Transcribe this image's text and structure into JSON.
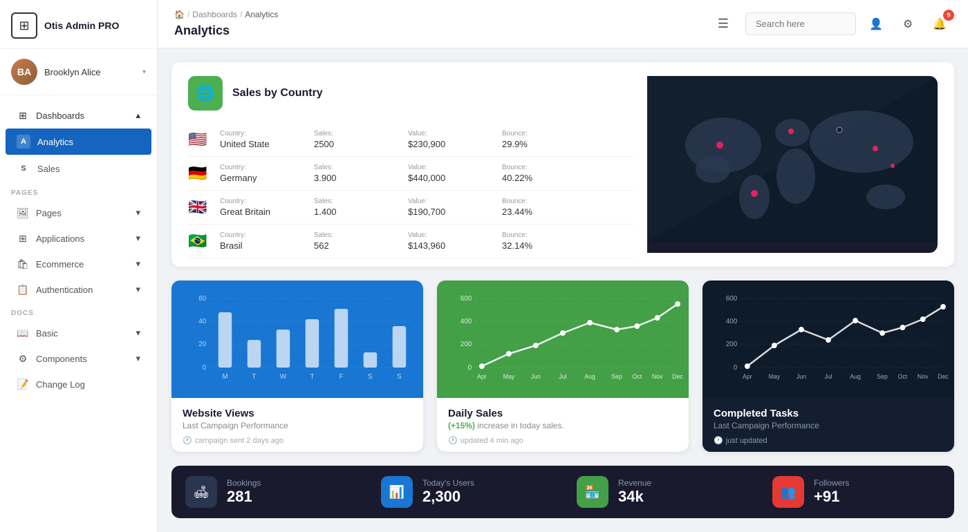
{
  "sidebar": {
    "logo": {
      "icon": "⊞",
      "text": "Otis Admin PRO"
    },
    "user": {
      "name": "Brooklyn Alice",
      "initials": "BA"
    },
    "nav": {
      "dashboards_label": "Dashboards",
      "analytics_label": "Analytics",
      "sales_label": "Sales",
      "pages_section": "PAGES",
      "pages_label": "Pages",
      "applications_label": "Applications",
      "ecommerce_label": "Ecommerce",
      "authentication_label": "Authentication",
      "docs_section": "DOCS",
      "basic_label": "Basic",
      "components_label": "Components",
      "changelog_label": "Change Log"
    }
  },
  "topbar": {
    "breadcrumb": {
      "home": "🏠",
      "sep1": "/",
      "dashboards": "Dashboards",
      "sep2": "/",
      "current": "Analytics"
    },
    "title": "Analytics",
    "hamburger": "☰",
    "search_placeholder": "Search here",
    "notification_count": "9"
  },
  "sales_country": {
    "card_title": "Sales by Country",
    "rows": [
      {
        "flag": "🇺🇸",
        "country_label": "Country:",
        "country": "United State",
        "sales_label": "Sales:",
        "sales": "2500",
        "value_label": "Value:",
        "value": "$230,900",
        "bounce_label": "Bounce:",
        "bounce": "29.9%"
      },
      {
        "flag": "🇩🇪",
        "country_label": "Country:",
        "country": "Germany",
        "sales_label": "Sales:",
        "sales": "3.900",
        "value_label": "Value:",
        "value": "$440,000",
        "bounce_label": "Bounce:",
        "bounce": "40.22%"
      },
      {
        "flag": "🇬🇧",
        "country_label": "Country:",
        "country": "Great Britain",
        "sales_label": "Sales:",
        "sales": "1.400",
        "value_label": "Value:",
        "value": "$190,700",
        "bounce_label": "Bounce:",
        "bounce": "23.44%"
      },
      {
        "flag": "🇧🇷",
        "country_label": "Country:",
        "country": "Brasil",
        "sales_label": "Sales:",
        "sales": "562",
        "value_label": "Value:",
        "value": "$143,960",
        "bounce_label": "Bounce:",
        "bounce": "32.14%"
      }
    ]
  },
  "chart_website": {
    "title": "Website Views",
    "subtitle": "Last Campaign Performance",
    "time_label": "campaign sent 2 days ago",
    "y_labels": [
      "60",
      "40",
      "20",
      "0"
    ],
    "x_labels": [
      "M",
      "T",
      "W",
      "T",
      "F",
      "S",
      "S"
    ]
  },
  "chart_daily": {
    "title": "Daily Sales",
    "subtitle_prefix": "(+15%)",
    "subtitle_suffix": "increase in today sales.",
    "time_label": "updated 4 min ago",
    "y_labels": [
      "600",
      "400",
      "200",
      "0"
    ],
    "x_labels": [
      "Apr",
      "May",
      "Jun",
      "Jul",
      "Aug",
      "Sep",
      "Oct",
      "Nov",
      "Dec"
    ]
  },
  "chart_tasks": {
    "title": "Completed Tasks",
    "subtitle": "Last Campaign Performance",
    "time_label": "just updated",
    "y_labels": [
      "600",
      "400",
      "200",
      "0"
    ],
    "x_labels": [
      "Apr",
      "May",
      "Jun",
      "Jul",
      "Aug",
      "Sep",
      "Oct",
      "Nov",
      "Dec"
    ]
  },
  "stats": [
    {
      "icon": "🛋",
      "icon_class": "stat-icon-dark",
      "label": "Bookings",
      "value": "281"
    },
    {
      "icon": "📊",
      "icon_class": "stat-icon-blue",
      "label": "Today's Users",
      "value": "2,300"
    },
    {
      "icon": "🏪",
      "icon_class": "stat-icon-green",
      "label": "Revenue",
      "value": "34k"
    },
    {
      "icon": "👥",
      "icon_class": "stat-icon-red",
      "label": "Followers",
      "value": "+91"
    }
  ]
}
